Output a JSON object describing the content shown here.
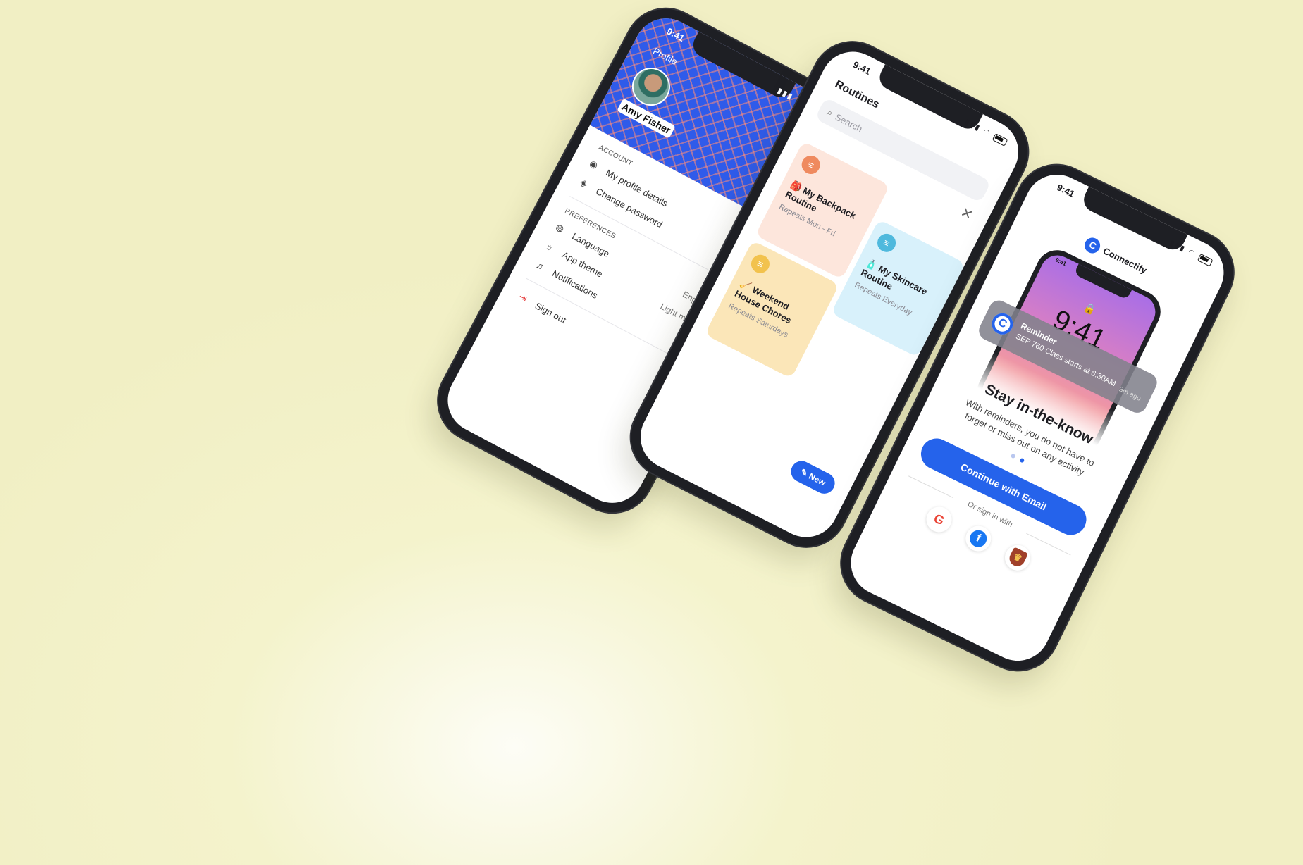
{
  "status": {
    "time": "9:41"
  },
  "profile": {
    "header_title": "Profile",
    "user_name": "Amy Fisher",
    "close_icon": "close-icon",
    "sections": {
      "account": "ACCOUNT",
      "preferences": "PREFERENCES"
    },
    "account_items": [
      {
        "label": "My profile details",
        "icon": "user-circle-icon"
      },
      {
        "label": "Change password",
        "icon": "shield-icon"
      }
    ],
    "preference_items": [
      {
        "label": "Language",
        "value": "English",
        "icon": "globe-icon"
      },
      {
        "label": "App theme",
        "value": "Light mode",
        "icon": "sun-icon"
      },
      {
        "label": "Notifications",
        "value": "",
        "icon": "bell-icon"
      }
    ],
    "sign_out": "Sign out",
    "colors": {
      "hero": "#2f5bea",
      "danger": "#e64040"
    }
  },
  "routines": {
    "title": "Routines",
    "search_placeholder": "Search",
    "cards": [
      {
        "title": "My Backpack Routine",
        "subtitle": "Repeats Mon - Fri",
        "color": "#fde6dc",
        "icon_color": "#ef8a5f",
        "emoji": "🎒"
      },
      {
        "title": "My Skincare Routine",
        "subtitle": "Repeats Everyday",
        "color": "#d8f1fb",
        "icon_color": "#4fb9dd",
        "emoji": "🧴"
      },
      {
        "title": "Weekend House Chores",
        "subtitle": "Repeats Saturdays",
        "color": "#fbe6b8",
        "icon_color": "#f2c24d",
        "emoji": "🧹"
      }
    ],
    "new_button": "New"
  },
  "onboarding": {
    "brand": "Connectify",
    "lock_time": "9:41",
    "notification": {
      "title": "Reminder",
      "body": "SEP 760 Class starts at 8:30AM",
      "when": "3m ago"
    },
    "headline": "Stay in-the-know",
    "body": "With reminders, you do not have to forget or miss out on any activity",
    "cta": "Continue with Email",
    "alt_signin": "Or sign in with",
    "providers": [
      "google-icon",
      "facebook-icon",
      "school-crest-icon"
    ],
    "accent": "#2563eb"
  }
}
